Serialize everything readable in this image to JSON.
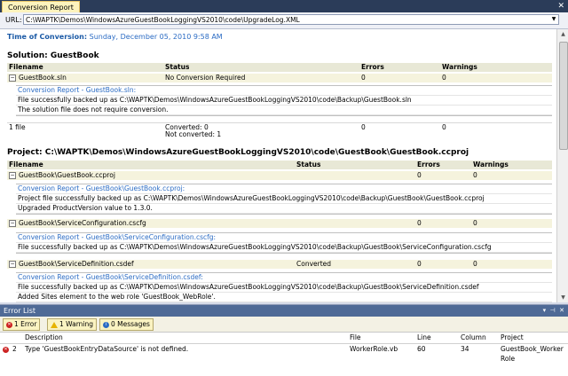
{
  "tab": {
    "title": "Conversion Report"
  },
  "url": {
    "label": "URL:",
    "value": "C:\\WAPTK\\Demos\\WindowsAzureGuestBookLoggingVS2010\\code\\UpgradeLog.XML"
  },
  "report": {
    "time_label": "Time of Conversion:",
    "time_value": "Sunday, December 05, 2010 9:58 AM",
    "solution": {
      "heading": "Solution: GuestBook",
      "headers": [
        "Filename",
        "Status",
        "Errors",
        "Warnings"
      ],
      "file": {
        "name": "GuestBook.sln",
        "status": "No Conversion Required",
        "errors": "0",
        "warnings": "0"
      },
      "details": [
        "Conversion Report - GuestBook.sln:",
        "File successfully backed up as C:\\WAPTK\\Demos\\WindowsAzureGuestBookLoggingVS2010\\code\\Backup\\GuestBook.sln",
        "The solution file does not require conversion."
      ],
      "summary": {
        "files": "1 file",
        "converted": "Converted: 0",
        "not_converted": "Not converted: 1",
        "errors": "0",
        "warnings": "0"
      }
    },
    "project": {
      "heading": "Project: C:\\WAPTK\\Demos\\WindowsAzureGuestBookLoggingVS2010\\code\\GuestBook\\GuestBook.ccproj",
      "headers": [
        "Filename",
        "Status",
        "Errors",
        "Warnings"
      ],
      "files": [
        {
          "name": "GuestBook\\GuestBook.ccproj",
          "status": "",
          "errors": "0",
          "warnings": "0",
          "details": [
            "Conversion Report - GuestBook\\GuestBook.ccproj:",
            "Project file successfully backed up as C:\\WAPTK\\Demos\\WindowsAzureGuestBookLoggingVS2010\\code\\Backup\\GuestBook\\GuestBook.ccproj",
            "Upgraded ProductVersion value to 1.3.0."
          ]
        },
        {
          "name": "GuestBook\\ServiceConfiguration.cscfg",
          "status": "",
          "errors": "0",
          "warnings": "0",
          "details": [
            "Conversion Report - GuestBook\\ServiceConfiguration.cscfg:",
            "File successfully backed up as C:\\WAPTK\\Demos\\WindowsAzureGuestBookLoggingVS2010\\code\\Backup\\GuestBook\\ServiceConfiguration.cscfg"
          ]
        },
        {
          "name": "GuestBook\\ServiceDefinition.csdef",
          "status": "Converted",
          "errors": "0",
          "warnings": "0",
          "details": [
            "Conversion Report - GuestBook\\ServiceDefinition.csdef:",
            "File successfully backed up as C:\\WAPTK\\Demos\\WindowsAzureGuestBookLoggingVS2010\\code\\Backup\\GuestBook\\ServiceDefinition.csdef",
            "Added Sites element to the web role 'GuestBook_WebRole'."
          ]
        }
      ]
    }
  },
  "error_list": {
    "title": "Error List",
    "filters": {
      "errors": "1 Error",
      "warnings": "1 Warning",
      "messages": "0 Messages"
    },
    "columns": [
      "Description",
      "File",
      "Line",
      "Column",
      "Project"
    ],
    "rows": [
      {
        "index": "2",
        "description": "Type 'GuestBookEntryDataSource' is not defined.",
        "file": "WorkerRole.vb",
        "line": "60",
        "column": "34",
        "project": "GuestBook_WorkerRole"
      }
    ]
  }
}
